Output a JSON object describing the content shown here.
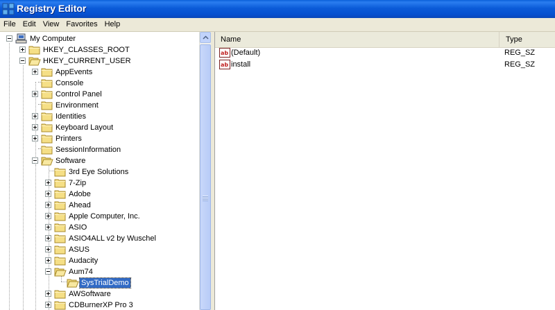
{
  "window": {
    "title": "Registry Editor"
  },
  "menu": [
    "File",
    "Edit",
    "View",
    "Favorites",
    "Help"
  ],
  "tree": {
    "root": "My Computer",
    "nodes": [
      {
        "label": "HKEY_CLASSES_ROOT",
        "expander": "plus"
      },
      {
        "label": "HKEY_CURRENT_USER",
        "expander": "minus"
      },
      {
        "label": "AppEvents",
        "expander": "plus"
      },
      {
        "label": "Console",
        "expander": "none"
      },
      {
        "label": "Control Panel",
        "expander": "plus"
      },
      {
        "label": "Environment",
        "expander": "none"
      },
      {
        "label": "Identities",
        "expander": "plus"
      },
      {
        "label": "Keyboard Layout",
        "expander": "plus"
      },
      {
        "label": "Printers",
        "expander": "plus"
      },
      {
        "label": "SessionInformation",
        "expander": "none"
      },
      {
        "label": "Software",
        "expander": "minus"
      },
      {
        "label": "3rd Eye Solutions",
        "expander": "none"
      },
      {
        "label": "7-Zip",
        "expander": "plus"
      },
      {
        "label": "Adobe",
        "expander": "plus"
      },
      {
        "label": "Ahead",
        "expander": "plus"
      },
      {
        "label": "Apple Computer, Inc.",
        "expander": "plus"
      },
      {
        "label": "ASIO",
        "expander": "plus"
      },
      {
        "label": "ASIO4ALL v2 by Wuschel",
        "expander": "plus"
      },
      {
        "label": "ASUS",
        "expander": "plus"
      },
      {
        "label": "Audacity",
        "expander": "plus"
      },
      {
        "label": "Aum74",
        "expander": "minus"
      },
      {
        "label": "SysTrialDemo",
        "expander": "none",
        "selected": true
      },
      {
        "label": "AWSoftware",
        "expander": "plus"
      },
      {
        "label": "CDBurnerXP Pro 3",
        "expander": "plus"
      }
    ]
  },
  "list": {
    "columns": {
      "name": "Name",
      "type": "Type"
    },
    "rows": [
      {
        "name": "(Default)",
        "type": "REG_SZ"
      },
      {
        "name": "install",
        "type": "REG_SZ"
      }
    ]
  }
}
